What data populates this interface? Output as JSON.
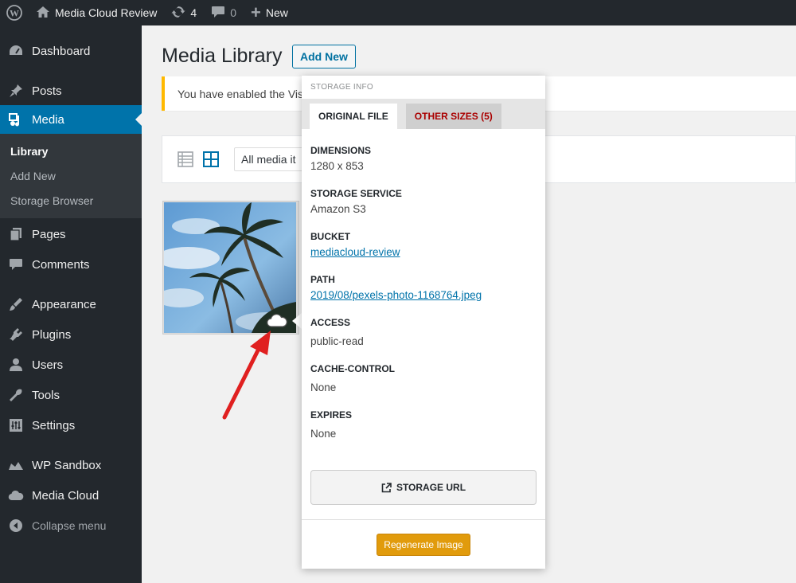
{
  "admin_bar": {
    "site_name": "Media Cloud Review",
    "updates_count": "4",
    "comments_count": "0",
    "new_label": "New"
  },
  "sidebar": {
    "items": [
      {
        "label": "Dashboard",
        "icon": "dashboard-icon"
      },
      {
        "label": "Posts",
        "icon": "pin-icon"
      },
      {
        "label": "Media",
        "icon": "media-icon"
      },
      {
        "label": "Pages",
        "icon": "pages-icon"
      },
      {
        "label": "Comments",
        "icon": "comment-icon"
      },
      {
        "label": "Appearance",
        "icon": "brush-icon"
      },
      {
        "label": "Plugins",
        "icon": "plugin-icon"
      },
      {
        "label": "Users",
        "icon": "user-icon"
      },
      {
        "label": "Tools",
        "icon": "wrench-icon"
      },
      {
        "label": "Settings",
        "icon": "sliders-icon"
      },
      {
        "label": "WP Sandbox",
        "icon": "sandbox-icon"
      },
      {
        "label": "Media Cloud",
        "icon": "cloud-icon"
      }
    ],
    "submenu": [
      "Library",
      "Add New",
      "Storage Browser"
    ],
    "collapse_label": "Collapse menu"
  },
  "main": {
    "title": "Media Library",
    "add_new_label": "Add New",
    "notice_text": "You have enabled the Vis",
    "filter_value": "All media it"
  },
  "popup": {
    "header": "STORAGE INFO",
    "tabs": [
      "ORIGINAL FILE",
      "OTHER SIZES (5)"
    ],
    "fields": {
      "dimensions": {
        "label": "DIMENSIONS",
        "value": "1280 x 853"
      },
      "service": {
        "label": "STORAGE SERVICE",
        "value": "Amazon S3"
      },
      "bucket": {
        "label": "BUCKET",
        "value": "mediacloud-review"
      },
      "path": {
        "label": "PATH",
        "value": "2019/08/pexels-photo-1168764.jpeg"
      },
      "access": {
        "label": "ACCESS",
        "value": "public-read"
      },
      "cache_control": {
        "label": "CACHE-CONTROL",
        "value": "None"
      },
      "expires": {
        "label": "EXPIRES",
        "value": "None"
      }
    },
    "storage_url_label": "STORAGE URL",
    "regenerate_label": "Regenerate Image"
  },
  "colors": {
    "admin_dark": "#23282d",
    "accent_blue": "#0073aa",
    "notice_yellow": "#ffb900",
    "tab_red": "#aa0000",
    "regen_orange": "#e19b0c",
    "arrow_red": "#e02020"
  }
}
